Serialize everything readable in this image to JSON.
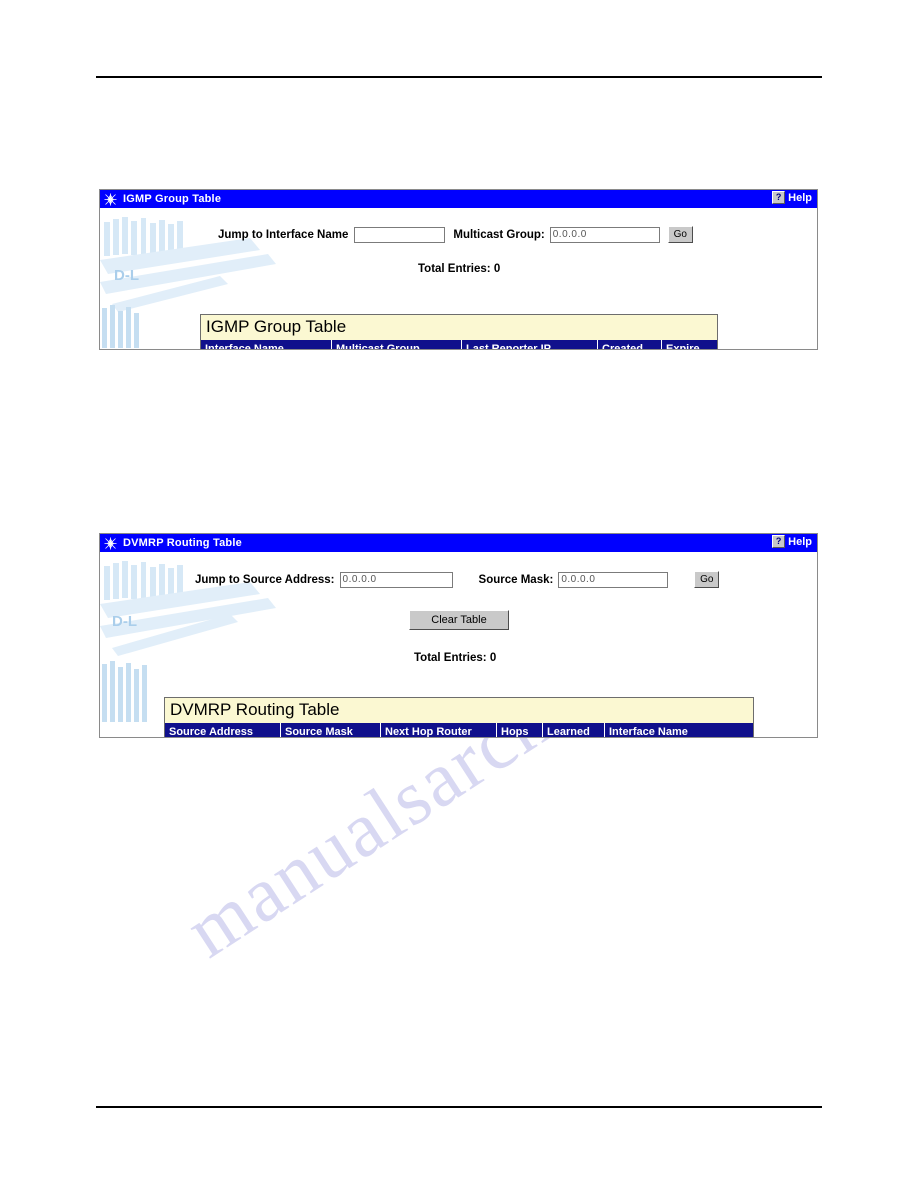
{
  "page": {
    "watermark_text": "manualsarchive.com",
    "rules": {
      "top": "",
      "bottom": ""
    }
  },
  "panels": [
    {
      "id": "igmp",
      "titlebar": {
        "icon": "spider-web-icon",
        "title": "IGMP Group Table",
        "help_glyph": "?",
        "help_label": "Help"
      },
      "form": {
        "field1_label": "Jump to Interface Name",
        "field1_value": "",
        "field2_label": "Multicast Group:",
        "field2_value": "0.0.0.0",
        "go_label": "Go"
      },
      "total_entries": "Total Entries: 0",
      "table": {
        "title": "IGMP Group Table",
        "columns": [
          "Interface Name",
          "Multicast Group",
          "Last Reporter IP",
          "Created",
          "Expire"
        ],
        "rows": []
      }
    },
    {
      "id": "dvmrp",
      "titlebar": {
        "icon": "spider-web-icon",
        "title": "DVMRP Routing Table",
        "help_glyph": "?",
        "help_label": "Help"
      },
      "form": {
        "field1_label": "Jump to Source Address:",
        "field1_value": "0.0.0.0",
        "field2_label": "Source Mask:",
        "field2_value": "0.0.0.0",
        "go_label": "Go"
      },
      "clear_button_label": "Clear Table",
      "total_entries": "Total Entries: 0",
      "table": {
        "title": "DVMRP Routing Table",
        "columns": [
          "Source Address",
          "Source Mask",
          "Next Hop Router",
          "Hops",
          "Learned",
          "Interface Name"
        ],
        "rows": []
      }
    }
  ],
  "colors": {
    "titlebar_blue": "#0000ff",
    "table_header_navy": "#10108c",
    "table_title_cream": "#fbf8d2",
    "button_face": "#c9c9c9",
    "watermark": "#d8d8f2"
  }
}
